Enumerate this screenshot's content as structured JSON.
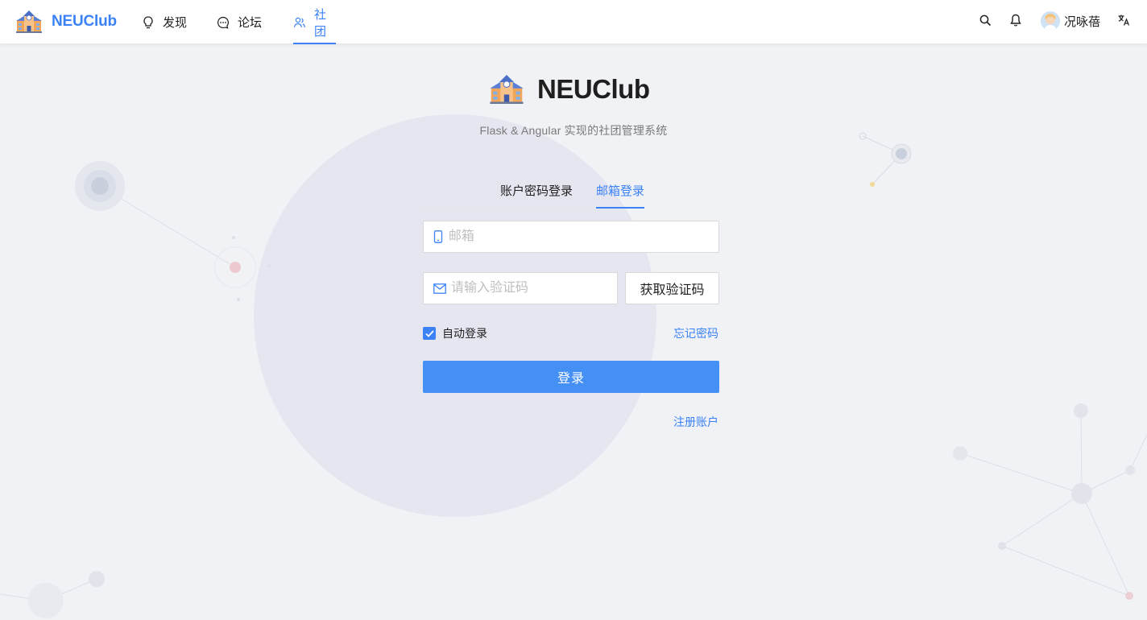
{
  "header": {
    "app_name": "NEUClub",
    "nav": [
      {
        "label": "发现",
        "icon": "bulb-icon",
        "active": false
      },
      {
        "label": "论坛",
        "icon": "message-icon",
        "active": false
      },
      {
        "label": "社团",
        "icon": "team-icon",
        "active": true
      }
    ],
    "user_name": "况咏蓓"
  },
  "login": {
    "brand_title": "NEUClub",
    "subtitle": "Flask & Angular 实现的社团管理系统",
    "tabs": [
      {
        "label": "账户密码登录",
        "active": false
      },
      {
        "label": "邮箱登录",
        "active": true
      }
    ],
    "email_placeholder": "邮箱",
    "code_placeholder": "请输入验证码",
    "get_code_label": "获取验证码",
    "auto_login_label": "自动登录",
    "auto_login_checked": true,
    "forgot_label": "忘记密码",
    "submit_label": "登录",
    "register_label": "注册账户"
  },
  "colors": {
    "accent": "#3b82f6",
    "button": "#4590f5",
    "background": "#f0f2f5",
    "blob": "#e6e6f2"
  }
}
